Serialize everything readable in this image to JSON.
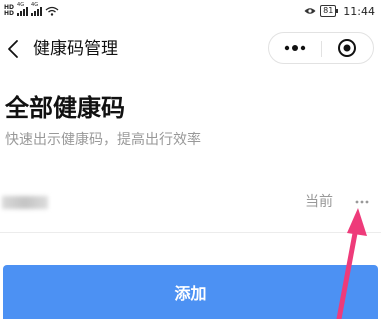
{
  "status_bar": {
    "network_1": "4G",
    "network_2": "4G",
    "battery": "81",
    "time": "11:44",
    "icons": [
      "hd-icon",
      "signal-icon",
      "wifi-icon",
      "eye-comfort-icon",
      "battery-icon"
    ]
  },
  "nav": {
    "title": "健康码管理",
    "icons": [
      "back-icon",
      "more-icon",
      "close-target-icon"
    ]
  },
  "main": {
    "title": "全部健康码",
    "subtitle": "快速出示健康码，提高出行效率",
    "rows": [
      {
        "status": "当前"
      }
    ],
    "add_label": "添加"
  },
  "annotation": {
    "icon": "pointer-arrow",
    "color": "#ee3b7a"
  },
  "colors": {
    "primary": "#4c91f3",
    "muted_text": "#999999",
    "annotation": "#ee3b7a"
  }
}
